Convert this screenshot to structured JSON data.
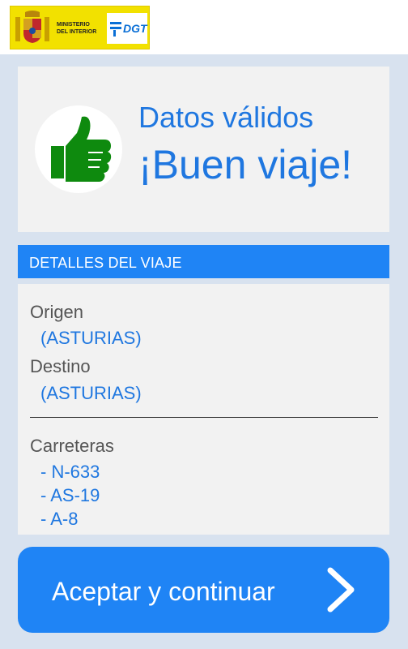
{
  "header": {
    "ministry_text": "MINISTERIO\nDEL INTERIOR",
    "agency_text": "DGT"
  },
  "result": {
    "line1": "Datos válidos",
    "line2": "¡Buen viaje!",
    "icon": "thumbs-up-icon"
  },
  "details": {
    "section_title": "DETALLES DEL VIAJE",
    "origin_label": "Origen",
    "origin_value": "(ASTURIAS)",
    "destination_label": "Destino",
    "destination_value": "(ASTURIAS)",
    "roads_label": "Carreteras",
    "roads": [
      "- N-633",
      "- AS-19",
      "- A-8"
    ]
  },
  "action": {
    "continue_label": "Aceptar y continuar",
    "icon": "chevron-right-icon"
  },
  "colors": {
    "accent": "#1f84f5",
    "text_blue": "#1f77e0",
    "thumb_green": "#0e8a0e",
    "logo_yellow": "#f2e100",
    "background": "#d8e2ef"
  }
}
